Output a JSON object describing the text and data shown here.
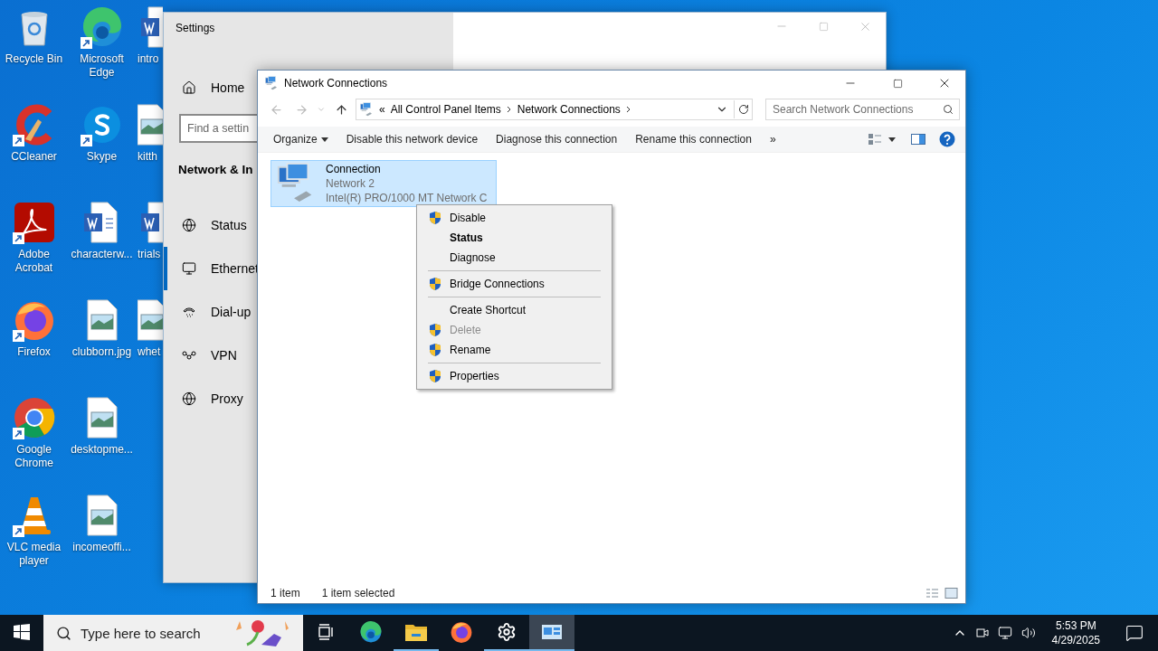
{
  "desktop": {
    "icons": [
      {
        "label": "Recycle Bin",
        "kind": "recycle",
        "shortcut": false
      },
      {
        "label": "CCleaner",
        "kind": "ccleaner",
        "shortcut": true
      },
      {
        "label": "Adobe Acrobat",
        "kind": "acrobat",
        "shortcut": true
      },
      {
        "label": "Firefox",
        "kind": "firefox",
        "shortcut": true
      },
      {
        "label": "Google Chrome",
        "kind": "chrome",
        "shortcut": true
      },
      {
        "label": "VLC media player",
        "kind": "vlc",
        "shortcut": true
      },
      {
        "label": "Microsoft Edge",
        "kind": "edge",
        "shortcut": true
      },
      {
        "label": "Skype",
        "kind": "skype",
        "shortcut": true
      },
      {
        "label": "characterw...",
        "kind": "word",
        "shortcut": false
      },
      {
        "label": "clubborn.jpg",
        "kind": "image",
        "shortcut": false
      },
      {
        "label": "desktopme...",
        "kind": "image",
        "shortcut": false
      },
      {
        "label": "incomeoffi...",
        "kind": "image",
        "shortcut": false
      },
      {
        "label": "intro",
        "kind": "word",
        "shortcut": false
      },
      {
        "label": "kitth",
        "kind": "image",
        "shortcut": false
      },
      {
        "label": "trials",
        "kind": "word",
        "shortcut": false
      },
      {
        "label": "whet",
        "kind": "image",
        "shortcut": false
      }
    ]
  },
  "settings_window": {
    "title": "Settings",
    "home": "Home",
    "search": {
      "placeholder": "Find a settin"
    },
    "section": "Network & In",
    "nav": [
      {
        "label": "Status",
        "kind": "status",
        "selected": false
      },
      {
        "label": "Ethernet",
        "kind": "ethernet",
        "selected": true
      },
      {
        "label": "Dial-up",
        "kind": "dialup",
        "selected": false
      },
      {
        "label": "VPN",
        "kind": "vpn",
        "selected": false
      },
      {
        "label": "Proxy",
        "kind": "proxy",
        "selected": false
      }
    ]
  },
  "network_window": {
    "title": "Network Connections",
    "address": {
      "overflow": "«",
      "crumbs": [
        "All Control Panel Items",
        "Network Connections"
      ]
    },
    "search": {
      "placeholder": "Search Network Connections"
    },
    "commands": [
      {
        "label": "Organize",
        "dropdown": true
      },
      {
        "label": "Disable this network device",
        "dropdown": false
      },
      {
        "label": "Diagnose this connection",
        "dropdown": false
      },
      {
        "label": "Rename this connection",
        "dropdown": false
      }
    ],
    "more": "»",
    "connections": [
      {
        "name": "Connection",
        "network": "Network 2",
        "adapter": "Intel(R) PRO/1000 MT Network C",
        "selected": true
      }
    ],
    "status_bar": [
      "1 item",
      "1 item selected"
    ]
  },
  "context_menu": {
    "items": [
      {
        "kind": "item",
        "label": "Disable",
        "shield": true,
        "default": false,
        "disabled": false
      },
      {
        "kind": "item",
        "label": "Status",
        "shield": false,
        "default": true,
        "disabled": false
      },
      {
        "kind": "item",
        "label": "Diagnose",
        "shield": false,
        "default": false,
        "disabled": false
      },
      {
        "kind": "separator"
      },
      {
        "kind": "item",
        "label": "Bridge Connections",
        "shield": true,
        "default": false,
        "disabled": false
      },
      {
        "kind": "separator"
      },
      {
        "kind": "item",
        "label": "Create Shortcut",
        "shield": false,
        "default": false,
        "disabled": false
      },
      {
        "kind": "item",
        "label": "Delete",
        "shield": true,
        "default": false,
        "disabled": true
      },
      {
        "kind": "item",
        "label": "Rename",
        "shield": true,
        "default": false,
        "disabled": false
      },
      {
        "kind": "separator"
      },
      {
        "kind": "item",
        "label": "Properties",
        "shield": true,
        "default": false,
        "disabled": false
      }
    ]
  },
  "taskbar": {
    "search": {
      "placeholder": "Type here to search"
    },
    "apps": [
      {
        "kind": "taskview",
        "running": false,
        "selected": false
      },
      {
        "kind": "edge",
        "running": false,
        "selected": false
      },
      {
        "kind": "explorer",
        "running": true,
        "selected": false
      },
      {
        "kind": "firefox",
        "running": false,
        "selected": false
      },
      {
        "kind": "settings",
        "running": true,
        "selected": false
      },
      {
        "kind": "network",
        "running": true,
        "selected": true
      }
    ],
    "time": "5:53 PM",
    "date": "4/29/2025"
  }
}
